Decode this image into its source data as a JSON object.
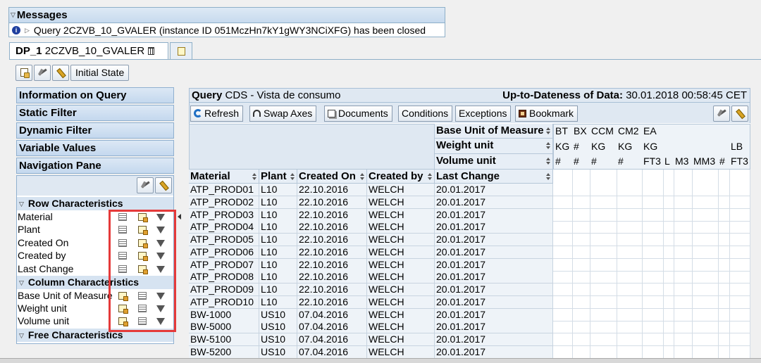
{
  "messages": {
    "title": "Messages",
    "text": "Query 2CZVB_10_GVALER (instance ID 051MczHn7kY1gWY3NCiXFG) has been closed"
  },
  "tabs": [
    {
      "prefix": "DP_1",
      "label": "2CZVB_10_GVALER"
    }
  ],
  "toolbar": {
    "initial_state": "Initial State"
  },
  "nav": {
    "items": [
      "Information on Query",
      "Static Filter",
      "Dynamic Filter",
      "Variable Values",
      "Navigation Pane"
    ],
    "row_section": "Row Characteristics",
    "row_items": [
      "Material",
      "Plant",
      "Created On",
      "Created by",
      "Last Change"
    ],
    "col_section": "Column Characteristics",
    "col_items": [
      "Base Unit of Measure",
      "Weight unit",
      "Volume unit"
    ],
    "free_section": "Free Characteristics"
  },
  "query": {
    "label": "Query",
    "name": "CDS - Vista de consumo",
    "date_label": "Up-to-Dateness of Data:",
    "date_value": "30.01.2018 00:58:45 CET",
    "buttons": [
      "Refresh",
      "Swap Axes",
      "Documents",
      "Conditions",
      "Exceptions",
      "Bookmark"
    ]
  },
  "table": {
    "col_dims": [
      "Base Unit of Measure",
      "Weight unit",
      "Volume unit"
    ],
    "base_units": [
      "BT",
      "BX",
      "CCM",
      "CM2",
      "EA"
    ],
    "weight_units": [
      "KG",
      "#",
      "KG",
      "KG",
      "KG",
      "LB"
    ],
    "volume_units": [
      "#",
      "#",
      "#",
      "#",
      "FT3",
      "L",
      "M3",
      "MM3",
      "#",
      "FT3"
    ],
    "headers": [
      "Material",
      "Plant",
      "Created On",
      "Created by",
      "Last Change"
    ],
    "rows": [
      [
        "ATP_PROD01",
        "L10",
        "22.10.2016",
        "WELCH",
        "20.01.2017"
      ],
      [
        "ATP_PROD02",
        "L10",
        "22.10.2016",
        "WELCH",
        "20.01.2017"
      ],
      [
        "ATP_PROD03",
        "L10",
        "22.10.2016",
        "WELCH",
        "20.01.2017"
      ],
      [
        "ATP_PROD04",
        "L10",
        "22.10.2016",
        "WELCH",
        "20.01.2017"
      ],
      [
        "ATP_PROD05",
        "L10",
        "22.10.2016",
        "WELCH",
        "20.01.2017"
      ],
      [
        "ATP_PROD06",
        "L10",
        "22.10.2016",
        "WELCH",
        "20.01.2017"
      ],
      [
        "ATP_PROD07",
        "L10",
        "22.10.2016",
        "WELCH",
        "20.01.2017"
      ],
      [
        "ATP_PROD08",
        "L10",
        "22.10.2016",
        "WELCH",
        "20.01.2017"
      ],
      [
        "ATP_PROD09",
        "L10",
        "22.10.2016",
        "WELCH",
        "20.01.2017"
      ],
      [
        "ATP_PROD10",
        "L10",
        "22.10.2016",
        "WELCH",
        "20.01.2017"
      ],
      [
        "BW-1000",
        "US10",
        "07.04.2016",
        "WELCH",
        "20.01.2017"
      ],
      [
        "BW-5000",
        "US10",
        "07.04.2016",
        "WELCH",
        "20.01.2017"
      ],
      [
        "BW-5100",
        "US10",
        "07.04.2016",
        "WELCH",
        "20.01.2017"
      ],
      [
        "BW-5200",
        "US10",
        "07.04.2016",
        "WELCH",
        "20.01.2017"
      ]
    ]
  },
  "colors": {
    "highlight": "#e53a3a",
    "header_bg": "#dfe8f2",
    "border": "#8eafc8"
  }
}
